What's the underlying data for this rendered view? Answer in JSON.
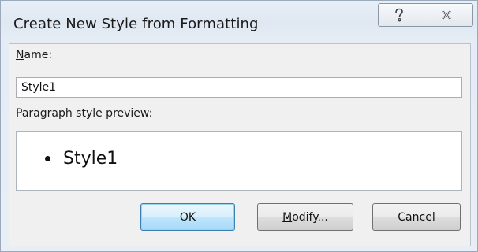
{
  "window": {
    "title": "Create New Style from Formatting",
    "help_icon": "question-mark-icon",
    "close_icon": "close-x-icon"
  },
  "form": {
    "name_label_accel": "N",
    "name_label_rest": "ame:",
    "name_value": "Style1",
    "preview_label": "Paragraph style preview:",
    "preview_text": "Style1"
  },
  "buttons": {
    "ok": "OK",
    "modify_accel": "M",
    "modify_rest": "odify...",
    "cancel": "Cancel"
  },
  "colors": {
    "ok_default_border": "#3c7fb1",
    "ok_default_fill": "#bee6fd"
  }
}
